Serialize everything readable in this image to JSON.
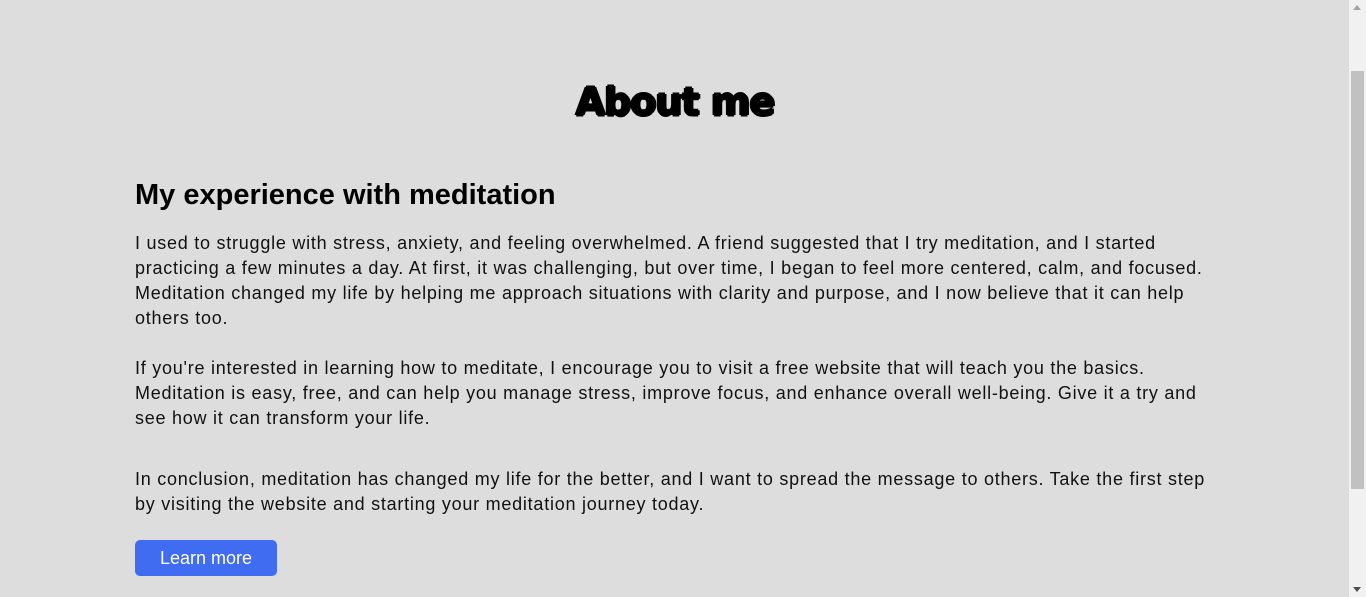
{
  "page": {
    "title": "About me"
  },
  "section": {
    "heading": "My experience with meditation",
    "paragraphs": [
      "I used to struggle with stress, anxiety, and feeling overwhelmed. A friend suggested that I try meditation, and I started practicing a few minutes a day. At first, it was challenging, but over time, I began to feel more centered, calm, and focused. Meditation changed my life by helping me approach situations with clarity and purpose, and I now believe that it can help others too.",
      "If you're interested in learning how to meditate, I encourage you to visit a free website that will teach you the basics. Meditation is easy, free, and can help you manage stress, improve focus, and enhance overall well-being. Give it a try and see how it can transform your life.",
      "In conclusion, meditation has changed my life for the better, and I want to spread the message to others. Take the first step by visiting the website and starting your meditation journey today."
    ],
    "button_label": "Learn more"
  },
  "colors": {
    "background": "#dddddd",
    "button": "#3f6cf0",
    "button_text": "#ffffff",
    "text": "#111111"
  },
  "icons": {
    "scroll_up": "chevron-up-icon",
    "scroll_down": "chevron-down-icon"
  }
}
